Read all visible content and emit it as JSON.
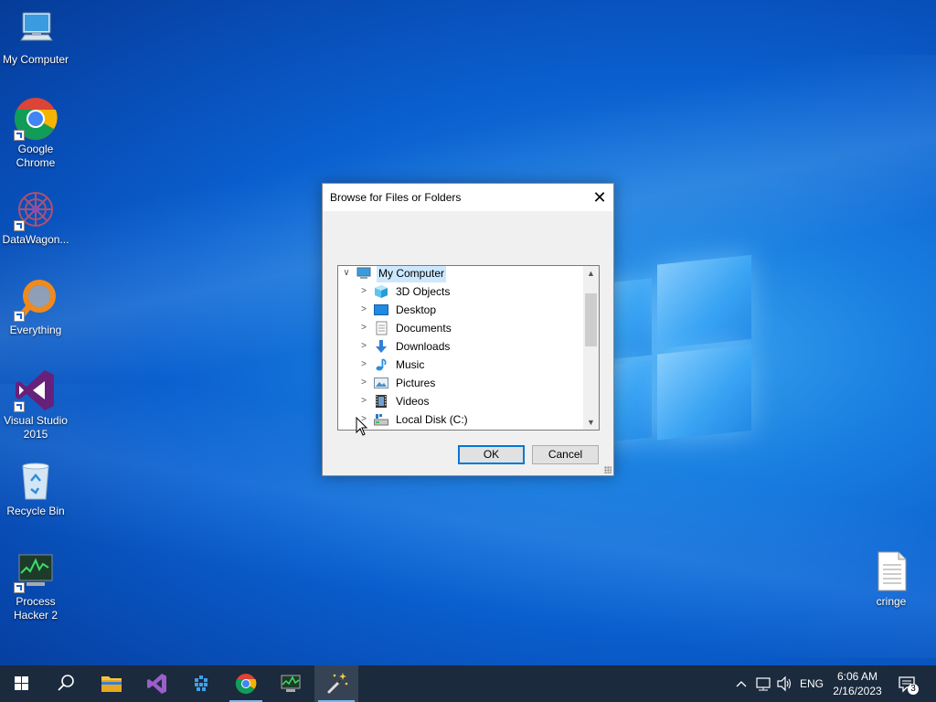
{
  "desktop": {
    "icons": [
      {
        "label": "My Computer"
      },
      {
        "label": "Google Chrome"
      },
      {
        "label": "DataWagon..."
      },
      {
        "label": "Everything"
      },
      {
        "label": "Visual Studio 2015"
      },
      {
        "label": "Recycle Bin"
      },
      {
        "label": "Process Hacker 2"
      },
      {
        "label": "cringe"
      }
    ]
  },
  "dialog": {
    "title": "Browse for Files or Folders",
    "tree": {
      "root": "My Computer",
      "items": [
        "3D Objects",
        "Desktop",
        "Documents",
        "Downloads",
        "Music",
        "Pictures",
        "Videos",
        "Local Disk (C:)"
      ]
    },
    "ok_label": "OK",
    "cancel_label": "Cancel"
  },
  "taskbar": {
    "language": "ENG",
    "time": "6:06 AM",
    "date": "2/16/2023",
    "notification_count": "3"
  },
  "colors": {
    "accent": "#0078d7",
    "selection": "#cce8ff",
    "taskbar": "#1b2a3d"
  }
}
